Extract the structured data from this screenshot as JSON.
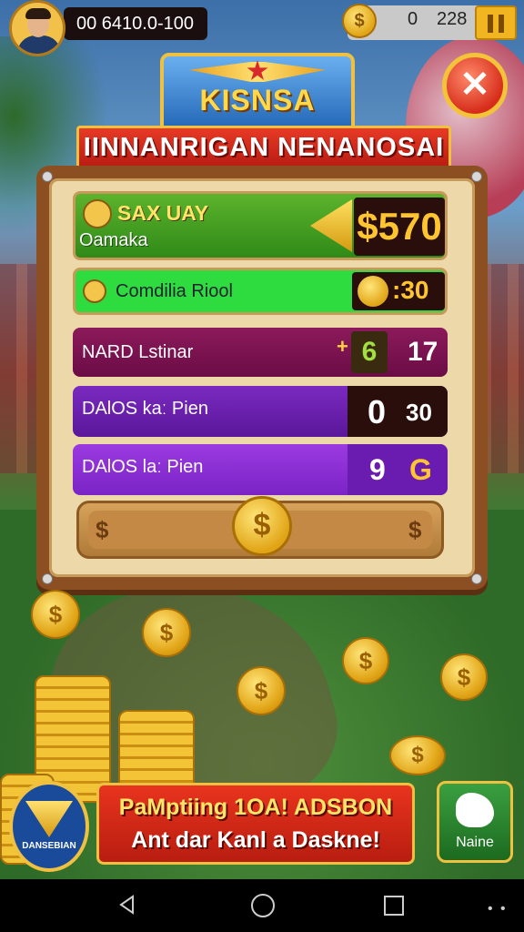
{
  "hud": {
    "balance_text": "00 6410.0-100",
    "coin_symbol": "$",
    "zero_value": "0",
    "coin_count": "228"
  },
  "header": {
    "crest_title": "KISNSA",
    "banner_title": "IINNANRIGAN NENANOSAI"
  },
  "rows": {
    "r1": {
      "title": "SAX UAY",
      "subtitle": "Oamaka",
      "value": "$570"
    },
    "r2": {
      "label": "Comdilia Riool",
      "value": ":30"
    },
    "r3": {
      "label": "NARD Lstinar",
      "plus": "+",
      "icon": "6",
      "value": "17"
    },
    "r4": {
      "label": "DAlOS kaː Pien",
      "value_a": "0",
      "value_b": "30"
    },
    "r5": {
      "label": "DAlOS laː Pien",
      "value_a": "9",
      "value_b": "G"
    }
  },
  "slider": {
    "left_symbol": "$",
    "right_symbol": "$",
    "knob_symbol": "$"
  },
  "promo": {
    "line1": "PaMptiing 1OA! ADSBON",
    "line2": "Ant dar Kanl a Daskne!"
  },
  "logo": {
    "text": "DANSEBIAN"
  },
  "name_button": {
    "label": "Naine"
  },
  "colors": {
    "accent_gold": "#f0c040",
    "close_red": "#d72e1c",
    "board_wood": "#8c4f22"
  }
}
